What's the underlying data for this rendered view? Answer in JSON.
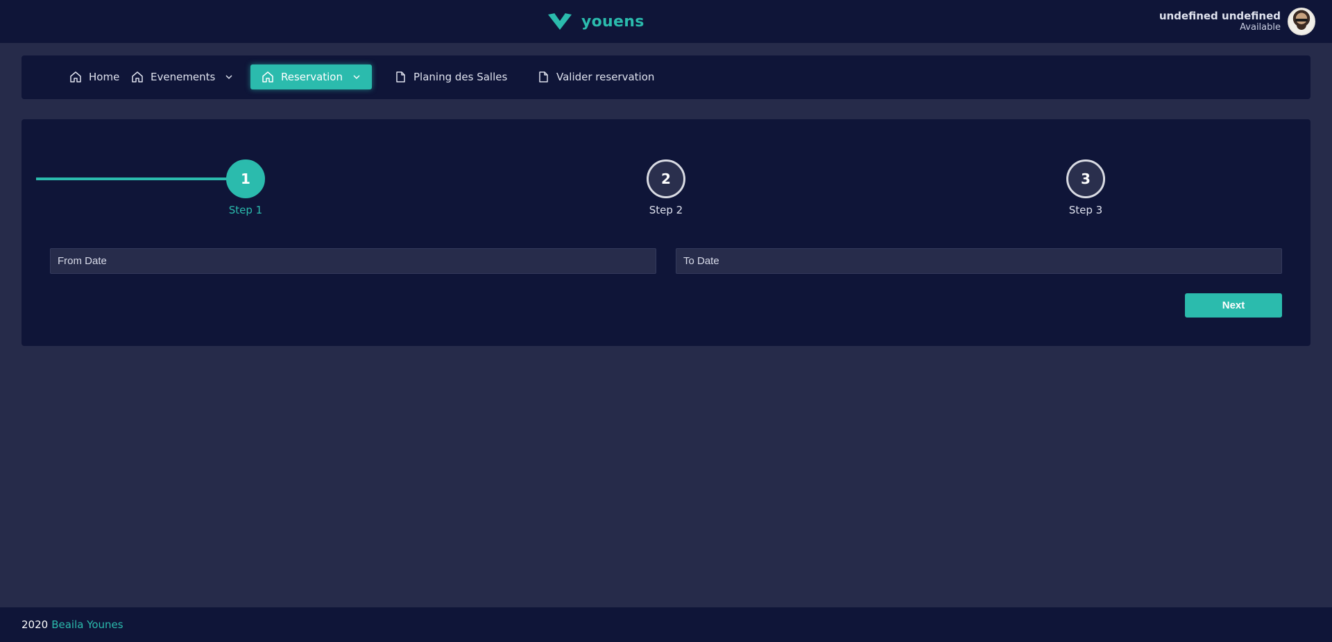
{
  "brand": {
    "name": "youens",
    "accent_color": "#2bbbad",
    "logo_icon": "v-heart-logo-icon"
  },
  "user": {
    "name": "undefined undefined",
    "status": "Available",
    "avatar_icon": "avatar"
  },
  "nav": {
    "items": [
      {
        "label": "Home",
        "icon": "home-icon"
      },
      {
        "label": "Evenements",
        "icon": "home-icon",
        "has_dropdown": true
      },
      {
        "label": "Reservation",
        "icon": "home-icon",
        "has_dropdown": true,
        "active": true
      },
      {
        "label": "Planing des Salles",
        "icon": "file-icon"
      },
      {
        "label": "Valider reservation",
        "icon": "file-icon"
      }
    ]
  },
  "stepper": {
    "current_step": 1,
    "steps": [
      {
        "number": "1",
        "label": "Step 1"
      },
      {
        "number": "2",
        "label": "Step 2"
      },
      {
        "number": "3",
        "label": "Step 3"
      }
    ]
  },
  "form": {
    "from_date_placeholder": "From Date",
    "to_date_placeholder": "To Date",
    "next_label": "Next"
  },
  "footer": {
    "year": "2020",
    "author": "Beaila Younes"
  }
}
